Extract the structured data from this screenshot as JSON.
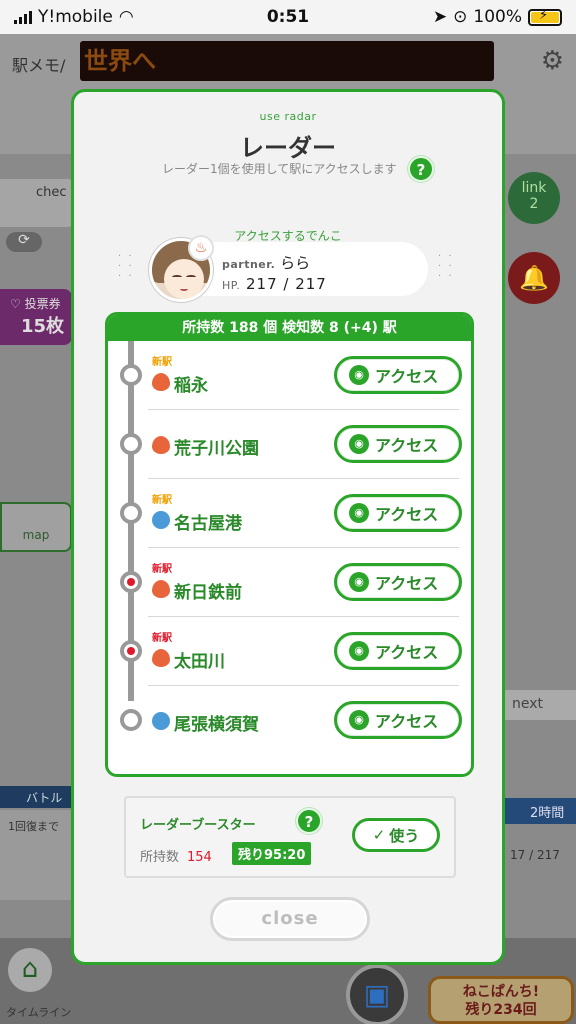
{
  "status_bar": {
    "carrier": "Y!mobile",
    "time": "0:51",
    "battery": "100%"
  },
  "background": {
    "logo": "駅メモ/",
    "marquee": "世界へ",
    "check_label": "chec",
    "vote_label": "♡ 投票券",
    "vote_count": "15枚",
    "map_label": "map",
    "link_label": "link",
    "link_count": "2",
    "next_label": "next",
    "battle_label": "バトル",
    "recover_label": "1回復まで",
    "hours_label": "2時間",
    "hp_fragment": "17 / 217",
    "timeline_label": "タイムライン",
    "cat_line1": "ねこぱんち!",
    "cat_line2": "残り234回"
  },
  "modal": {
    "subtitle": "use radar",
    "title": "レーダー",
    "description": "レーダー1個を使用して駅にアクセスします",
    "help_mark": "?",
    "access_label": "アクセスするでんこ",
    "partner_prefix": "partner.",
    "partner_name": "らら",
    "hp_prefix": "HP.",
    "hp_value": "217 / 217",
    "list_header": "所持数 188 個 検知数 8 (+4) 駅",
    "access_button_label": "アクセス",
    "stations": [
      {
        "name": "稲永",
        "tag": "新駅",
        "tag_color": "orange",
        "attr": "heat",
        "marked": false
      },
      {
        "name": "荒子川公園",
        "tag": "",
        "tag_color": "",
        "attr": "heat",
        "marked": false
      },
      {
        "name": "名古屋港",
        "tag": "新駅",
        "tag_color": "orange",
        "attr": "cool",
        "marked": false
      },
      {
        "name": "新日鉄前",
        "tag": "新駅",
        "tag_color": "red",
        "attr": "heat",
        "marked": true
      },
      {
        "name": "太田川",
        "tag": "新駅",
        "tag_color": "red",
        "attr": "heat",
        "marked": true
      },
      {
        "name": "尾張横須賀",
        "tag": "",
        "tag_color": "",
        "attr": "cool",
        "marked": false
      }
    ],
    "booster": {
      "title": "レーダーブースター",
      "owned_label": "所持数",
      "owned_count": "154",
      "remaining": "残り95:20",
      "use_label": "使う"
    },
    "close_label": "close"
  },
  "colors": {
    "accent": "#2aa52a",
    "new_orange": "#f0a000",
    "new_red": "#e0192a",
    "heat": "#e8643a",
    "cool": "#4a9ad8"
  },
  "icons": [
    "wifi-icon",
    "location-icon",
    "rotation-lock-icon",
    "battery-icon",
    "gear-icon",
    "refresh-icon",
    "bell-icon",
    "home-icon",
    "briefcase-icon",
    "radar-icon",
    "fire-icon",
    "water-icon"
  ]
}
